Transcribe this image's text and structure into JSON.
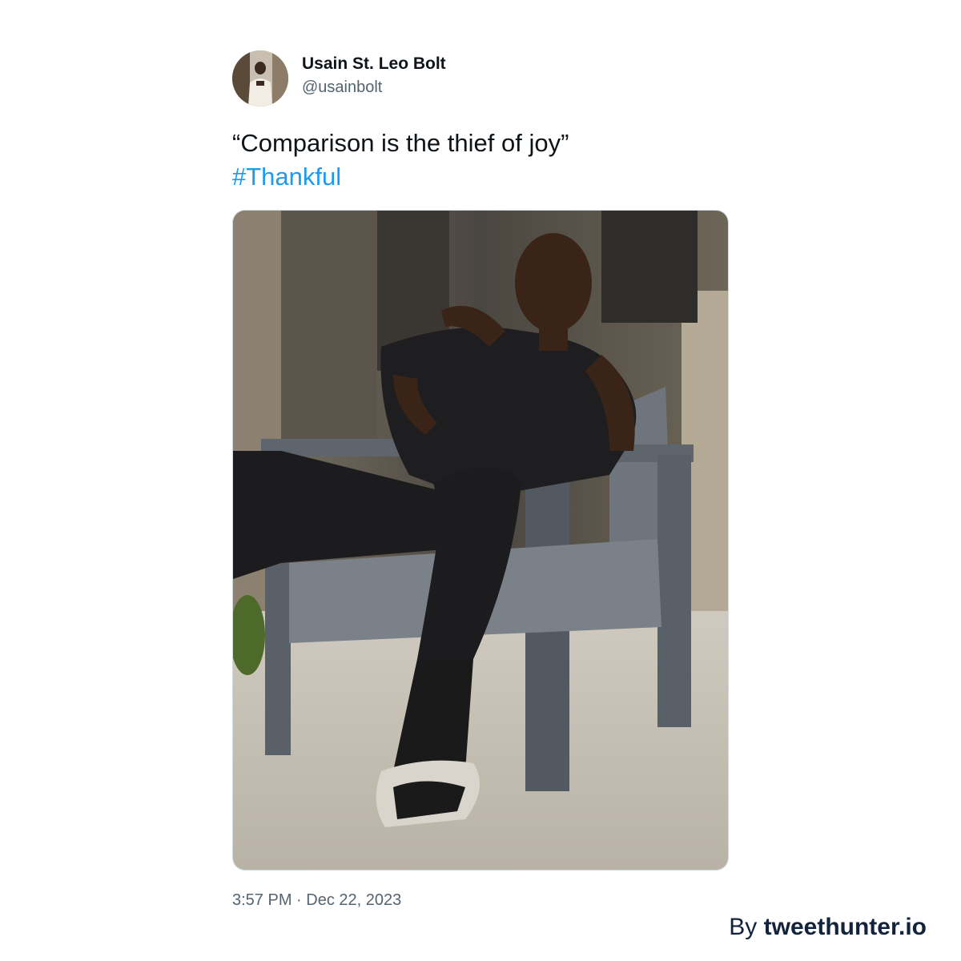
{
  "author": {
    "display_name": "Usain St. Leo Bolt",
    "handle": "@usainbolt",
    "avatar_icon": "profile-photo"
  },
  "tweet": {
    "text": "“Comparison is the thief of joy”",
    "hashtag": "#Thankful",
    "timestamp": "3:57 PM · Dec 22, 2023"
  },
  "watermark": {
    "prefix": "By",
    "brand": "tweethunter.io"
  },
  "colors": {
    "text_primary": "#0f1419",
    "text_secondary": "#536471",
    "link": "#1d9bf0",
    "watermark": "#14233c",
    "media_border": "#cfd9de"
  }
}
